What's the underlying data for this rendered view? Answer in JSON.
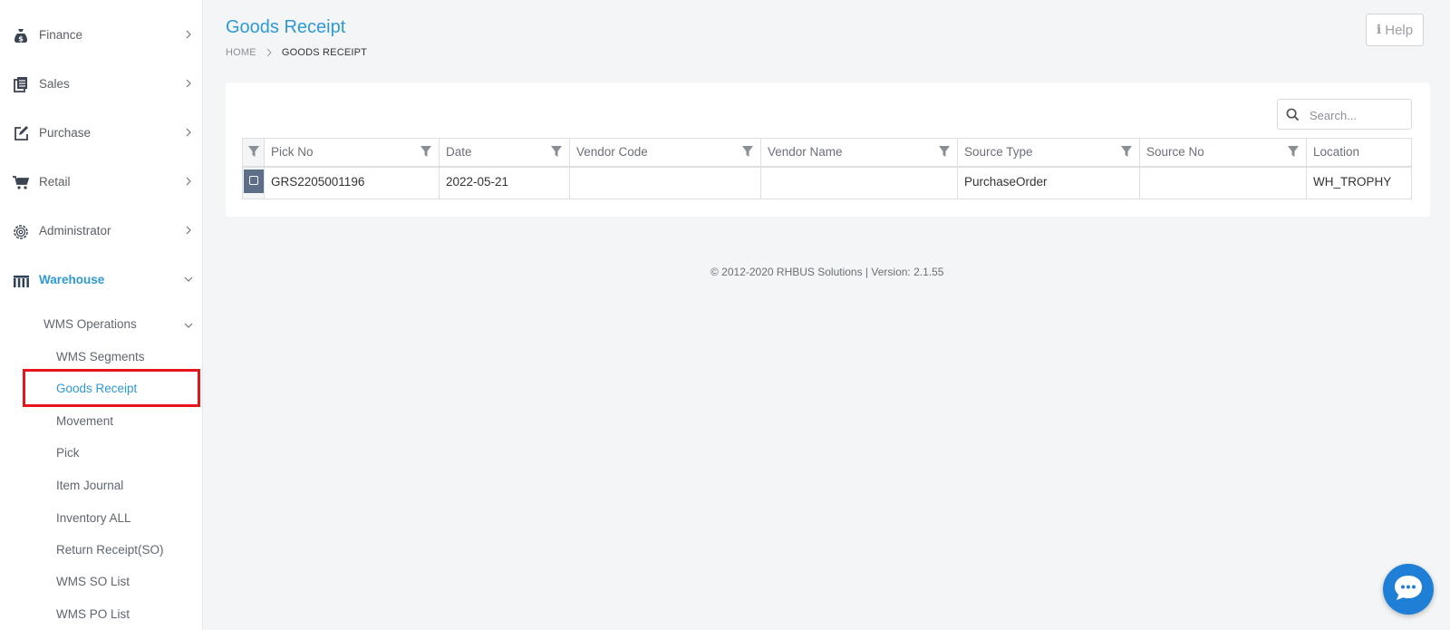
{
  "sidebar": {
    "items": [
      {
        "label": "Finance",
        "icon": "money-bag-icon"
      },
      {
        "label": "Sales",
        "icon": "document-list-icon"
      },
      {
        "label": "Purchase",
        "icon": "edit-square-icon"
      },
      {
        "label": "Retail",
        "icon": "cart-icon"
      },
      {
        "label": "Administrator",
        "icon": "gear-icon"
      },
      {
        "label": "Warehouse",
        "icon": "warehouse-icon",
        "active": true
      }
    ],
    "submenu_group": "WMS Operations",
    "submenu": [
      "WMS Segments",
      "Goods Receipt",
      "Movement",
      "Pick",
      "Item Journal",
      "Inventory ALL",
      "Return Receipt(SO)",
      "WMS SO List",
      "WMS PO List"
    ],
    "selected": "Goods Receipt"
  },
  "header": {
    "title": "Goods Receipt",
    "breadcrumb": {
      "home": "HOME",
      "current": "GOODS RECEIPT"
    },
    "help_label": "Help"
  },
  "search": {
    "placeholder": "Search..."
  },
  "table": {
    "columns": [
      "Pick No",
      "Date",
      "Vendor Code",
      "Vendor Name",
      "Source Type",
      "Source No",
      "Location"
    ],
    "rows": [
      {
        "pick_no": "GRS2205001196",
        "date": "2022-05-21",
        "vendor_code": "",
        "vendor_name": "",
        "source_type": "PurchaseOrder",
        "source_no": "",
        "location": "WH_TROPHY"
      }
    ]
  },
  "footer": {
    "text": "© 2012-2020 RHBUS Solutions | Version: 2.1.55"
  },
  "colors": {
    "accent": "#2d9ad6",
    "highlight": "#e8141b",
    "chat": "#1f7fd6",
    "checkbox": "#5d6e89"
  }
}
